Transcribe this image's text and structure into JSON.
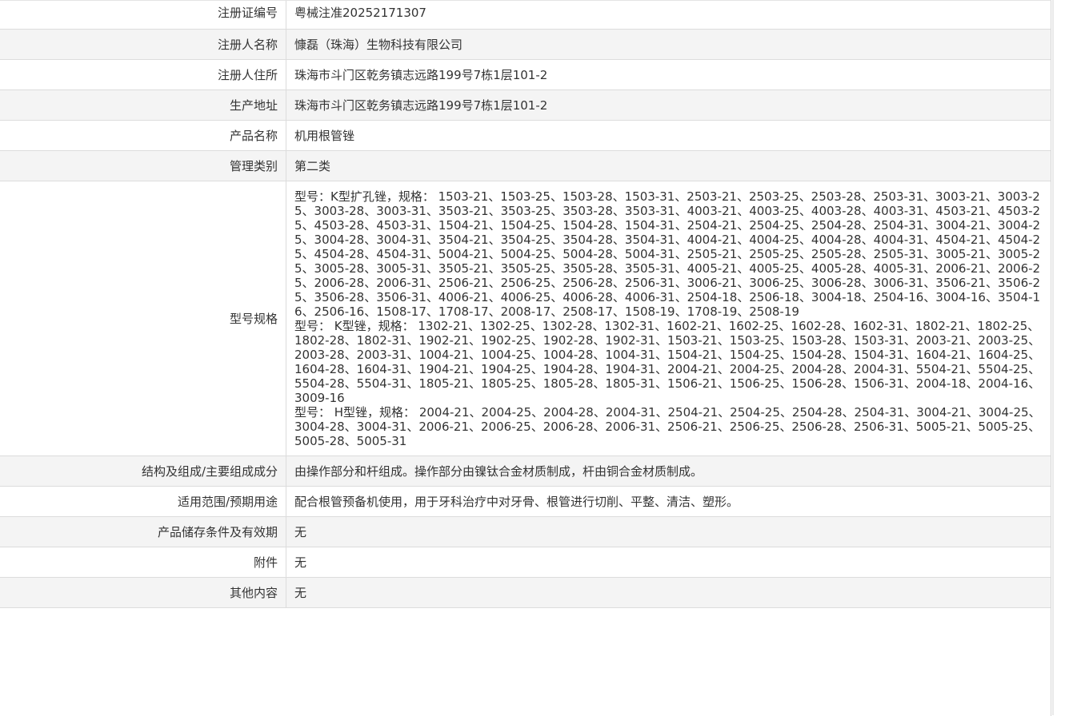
{
  "rows": [
    {
      "label": "注册证编号",
      "value": "粤械注准20252171307"
    },
    {
      "label": "注册人名称",
      "value": "慷磊（珠海）生物科技有限公司"
    },
    {
      "label": "注册人住所",
      "value": "珠海市斗门区乾务镇志远路199号7栋1层101-2"
    },
    {
      "label": "生产地址",
      "value": "珠海市斗门区乾务镇志远路199号7栋1层101-2"
    },
    {
      "label": "产品名称",
      "value": "机用根管锉"
    },
    {
      "label": "管理类别",
      "value": "第二类"
    },
    {
      "label": "型号规格",
      "values": [
        "型号：K型扩孔锉，规格： 1503-21、1503-25、1503-28、1503-31、2503-21、2503-25、2503-28、2503-31、3003-21、3003-25、3003-28、3003-31、3503-21、3503-25、3503-28、3503-31、4003-21、4003-25、4003-28、4003-31、4503-21、4503-25、4503-28、4503-31、1504-21、1504-25、1504-28、1504-31、2504-21、2504-25、2504-28、2504-31、3004-21、3004-25、3004-28、3004-31、3504-21、3504-25、3504-28、3504-31、4004-21、4004-25、4004-28、4004-31、4504-21、4504-25、4504-28、4504-31、5004-21、5004-25、5004-28、5004-31、2505-21、2505-25、2505-28、2505-31、3005-21、3005-25、3005-28、3005-31、3505-21、3505-25、3505-28、3505-31、4005-21、4005-25、4005-28、4005-31、2006-21、2006-25、2006-28、2006-31、2506-21、2506-25、2506-28、2506-31、3006-21、3006-25、3006-28、3006-31、3506-21、3506-25、3506-28、3506-31、4006-21、4006-25、4006-28、4006-31、2504-18、2506-18、3004-18、2504-16、3004-16、3504-16、2506-16、1508-17、1708-17、2008-17、2508-17、1508-19、1708-19、2508-19",
        "型号： K型锉，规格： 1302-21、1302-25、1302-28、1302-31、1602-21、1602-25、1602-28、1602-31、1802-21、1802-25、1802-28、1802-31、1902-21、1902-25、1902-28、1902-31、1503-21、1503-25、1503-28、1503-31、2003-21、2003-25、2003-28、2003-31、1004-21、1004-25、1004-28、1004-31、1504-21、1504-25、1504-28、1504-31、1604-21、1604-25、1604-28、1604-31、1904-21、1904-25、1904-28、1904-31、2004-21、2004-25、2004-28、2004-31、5504-21、5504-25、5504-28、5504-31、1805-21、1805-25、1805-28、1805-31、1506-21、1506-25、1506-28、1506-31、2004-18、2004-16、3009-16",
        "型号： H型锉，规格： 2004-21、2004-25、2004-28、2004-31、2504-21、2504-25、2504-28、2504-31、3004-21、3004-25、3004-28、3004-31、2006-21、2006-25、2006-28、2006-31、2506-21、2506-25、2506-28、2506-31、5005-21、5005-25、5005-28、5005-31"
      ]
    },
    {
      "label": "结构及组成/主要组成成分",
      "value": "由操作部分和杆组成。操作部分由镍钛合金材质制成，杆由铜合金材质制成。"
    },
    {
      "label": "适用范围/预期用途",
      "value": "配合根管预备机使用，用于牙科治疗中对牙骨、根管进行切削、平整、清洁、塑形。"
    },
    {
      "label": "产品储存条件及有效期",
      "value": "无"
    },
    {
      "label": "附件",
      "value": "无"
    },
    {
      "label": "其他内容",
      "value": "无"
    }
  ]
}
